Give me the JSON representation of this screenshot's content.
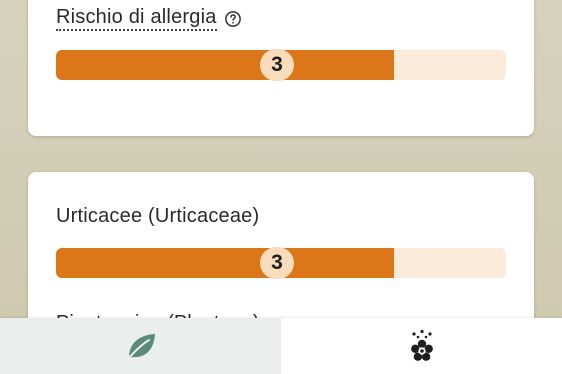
{
  "allergy_card": {
    "label": "Rischio di allergia",
    "help_icon": "help-circle-icon",
    "level": 3,
    "level_text": "3",
    "level_max": 4,
    "fill_color": "#dc7719",
    "track_color": "#fbebdb",
    "badge_color": "#f8dcbc"
  },
  "pollen_card": {
    "items": [
      {
        "label": "Urticacee (Urticaceae)",
        "level": 3,
        "level_text": "3",
        "level_max": 4
      },
      {
        "label": "Piantaggine (Plantago)"
      }
    ]
  },
  "bottom_nav": {
    "tabs": [
      {
        "name": "leaf",
        "icon": "leaf-icon",
        "active": true,
        "icon_color": "#5a8a7a"
      },
      {
        "name": "flower",
        "icon": "pollen-flower-icon",
        "active": false,
        "icon_color": "#1e1e1e"
      }
    ]
  }
}
